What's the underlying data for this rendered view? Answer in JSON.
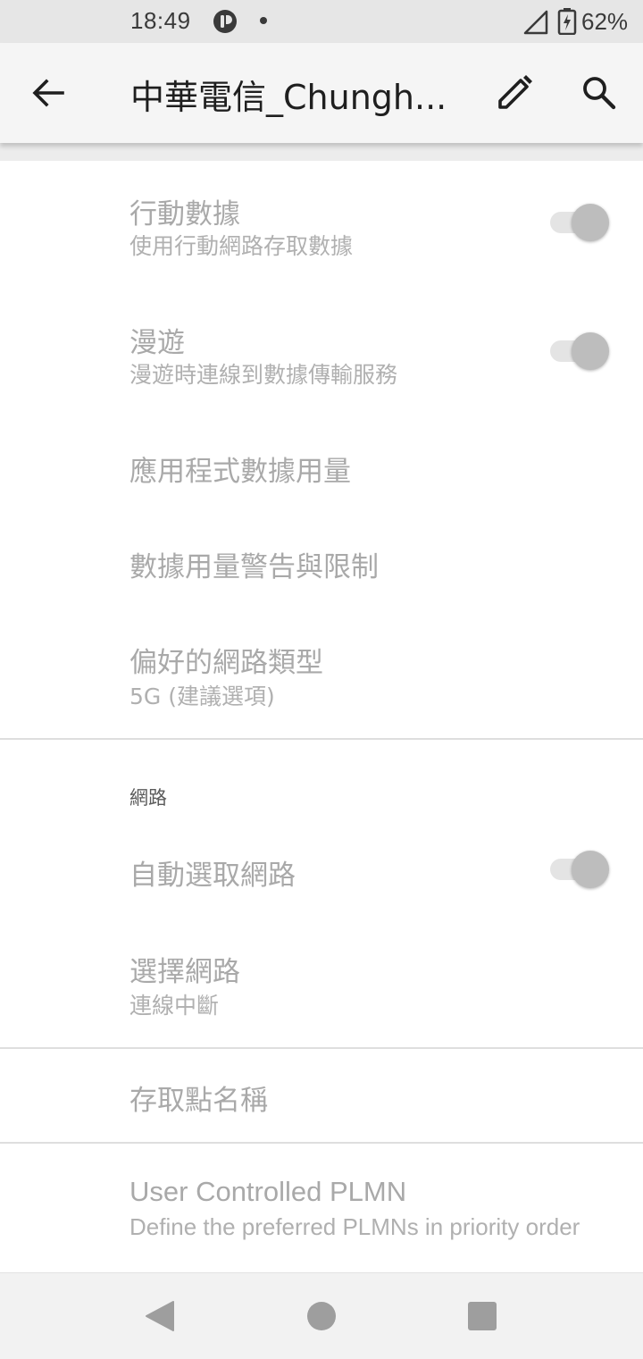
{
  "status_bar": {
    "time": "18:49",
    "battery_percent": "62%",
    "icons": [
      "notification-app-icon",
      "dot-icon",
      "signal-icon",
      "battery-charging-icon"
    ]
  },
  "app_bar": {
    "title": "中華電信_Chungh...",
    "icons": [
      "back-arrow-icon",
      "edit-pencil-icon",
      "search-icon"
    ]
  },
  "settings": {
    "mobile_data": {
      "title": "行動數據",
      "subtitle": "使用行動網路存取數據",
      "toggle_on": true
    },
    "roaming": {
      "title": "漫遊",
      "subtitle": "漫遊時連線到數據傳輸服務",
      "toggle_on": true
    },
    "app_data_usage": {
      "title": "應用程式數據用量"
    },
    "data_warning": {
      "title": "數據用量警告與限制"
    },
    "preferred_network": {
      "title": "偏好的網路類型",
      "subtitle": "5G (建議選項)"
    },
    "network_section": {
      "header": "網路"
    },
    "auto_select": {
      "title": "自動選取網路",
      "toggle_on": true
    },
    "choose_network": {
      "title": "選擇網路",
      "subtitle": "連線中斷"
    },
    "apn": {
      "title": "存取點名稱"
    },
    "plmn": {
      "title": "User Controlled PLMN",
      "subtitle": "Define the preferred PLMNs in priority order"
    }
  },
  "nav_bar": {
    "icons": [
      "nav-back-icon",
      "nav-home-icon",
      "nav-recents-icon"
    ]
  },
  "colors": {
    "disabled_text": "#a9a9a9",
    "toggle_thumb": "#bdbdbd",
    "app_bar_bg": "#f5f5f5",
    "status_bar_bg": "#e6e6e6"
  }
}
